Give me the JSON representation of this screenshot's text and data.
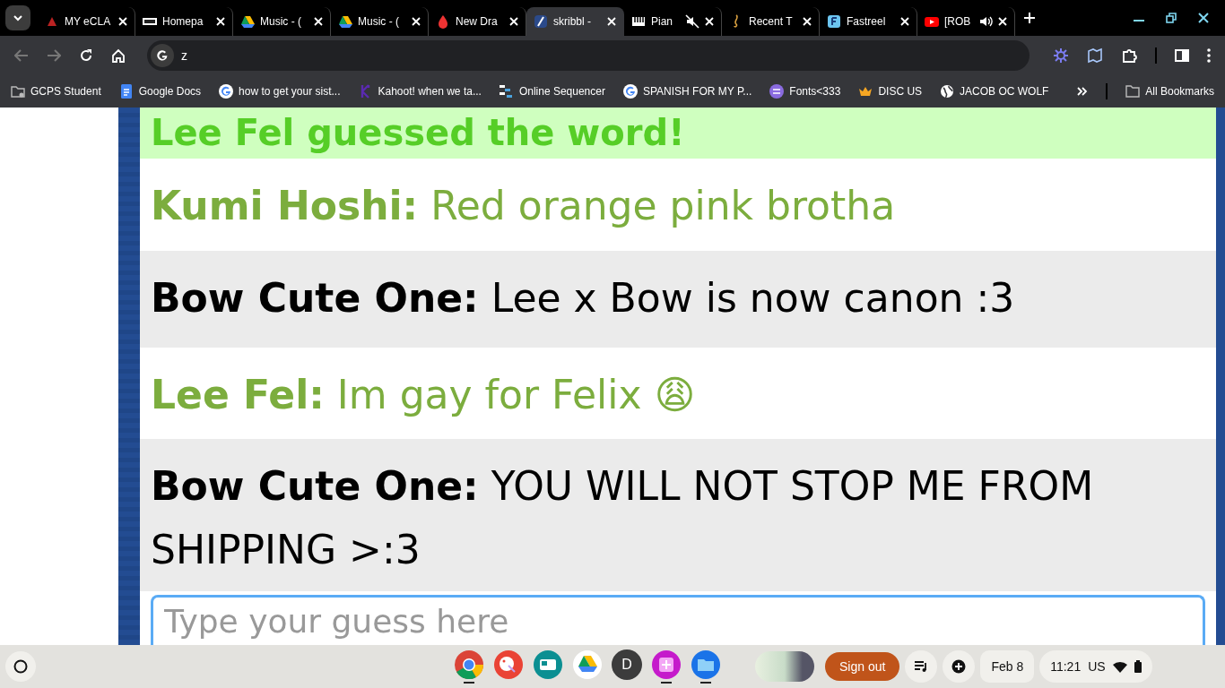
{
  "tabs": [
    {
      "kind": "eclass",
      "title": "MY eCLA",
      "selected": false,
      "muted": false,
      "playing_audio": false
    },
    {
      "kind": "d2l",
      "title": "Homepa",
      "selected": false,
      "muted": false,
      "playing_audio": false
    },
    {
      "kind": "drive",
      "title": "Music - (",
      "selected": false,
      "muted": false,
      "playing_audio": false
    },
    {
      "kind": "drive",
      "title": "Music - (",
      "selected": false,
      "muted": false,
      "playing_audio": false
    },
    {
      "kind": "draw",
      "title": "New Dra",
      "selected": false,
      "muted": false,
      "playing_audio": false
    },
    {
      "kind": "skribbl",
      "title": "skribbl -",
      "selected": true,
      "muted": false,
      "playing_audio": false
    },
    {
      "kind": "piano",
      "title": "Pian",
      "selected": false,
      "muted": true,
      "playing_audio": false
    },
    {
      "kind": "music",
      "title": "Recent T",
      "selected": false,
      "muted": false,
      "playing_audio": false
    },
    {
      "kind": "fastreel",
      "title": "Fastreel",
      "selected": false,
      "muted": false,
      "playing_audio": false
    },
    {
      "kind": "youtube",
      "title": "[ROB",
      "selected": false,
      "muted": false,
      "playing_audio": true
    }
  ],
  "address": {
    "value": "z"
  },
  "bookmarks": [
    {
      "kind": "folder-gear",
      "label": "GCPS Student"
    },
    {
      "kind": "docs",
      "label": "Google Docs"
    },
    {
      "kind": "google",
      "label": "how to get your sist..."
    },
    {
      "kind": "kahoot",
      "label": "Kahoot! when we ta..."
    },
    {
      "kind": "sequencer",
      "label": "Online Sequencer"
    },
    {
      "kind": "google",
      "label": "SPANISH FOR MY P..."
    },
    {
      "kind": "fonts",
      "label": "Fonts<333"
    },
    {
      "kind": "crown",
      "label": "DISC US"
    },
    {
      "kind": "globe",
      "label": "JACOB OC WOLF"
    }
  ],
  "all_bookmarks": "All Bookmarks",
  "messages": [
    {
      "kind": "guessed",
      "text": "Lee Fel guessed the word!",
      "color": "#56ce27"
    },
    {
      "kind": "chat",
      "name": "Kumi Hoshi:",
      "text": "Red orange pink brotha",
      "color": "#7cad3e"
    },
    {
      "kind": "chat",
      "name": "Bow Cute One:",
      "text": "Lee x Bow is now canon :3",
      "color": "#000000"
    },
    {
      "kind": "chat",
      "name": "Lee Fel:",
      "text": "Im gay for Felix 😩",
      "color": "#7cad3e"
    },
    {
      "kind": "chat",
      "name": "Bow Cute One:",
      "text": "YOU WILL NOT STOP ME FROM SHIPPING >:3",
      "color": "#000000"
    }
  ],
  "guess_input": {
    "placeholder": "Type your guess here"
  },
  "shelf": {
    "apps": [
      {
        "kind": "chrome",
        "running": true
      },
      {
        "kind": "paint",
        "running": false
      },
      {
        "kind": "news",
        "running": false
      },
      {
        "kind": "drive",
        "running": false
      },
      {
        "kind": "avatar",
        "letter": "D",
        "running": false
      },
      {
        "kind": "sparkle",
        "running": true
      },
      {
        "kind": "files",
        "running": true
      }
    ],
    "sign_out": "Sign out",
    "date": "Feb 8",
    "time": "11:21",
    "ime": "US"
  }
}
